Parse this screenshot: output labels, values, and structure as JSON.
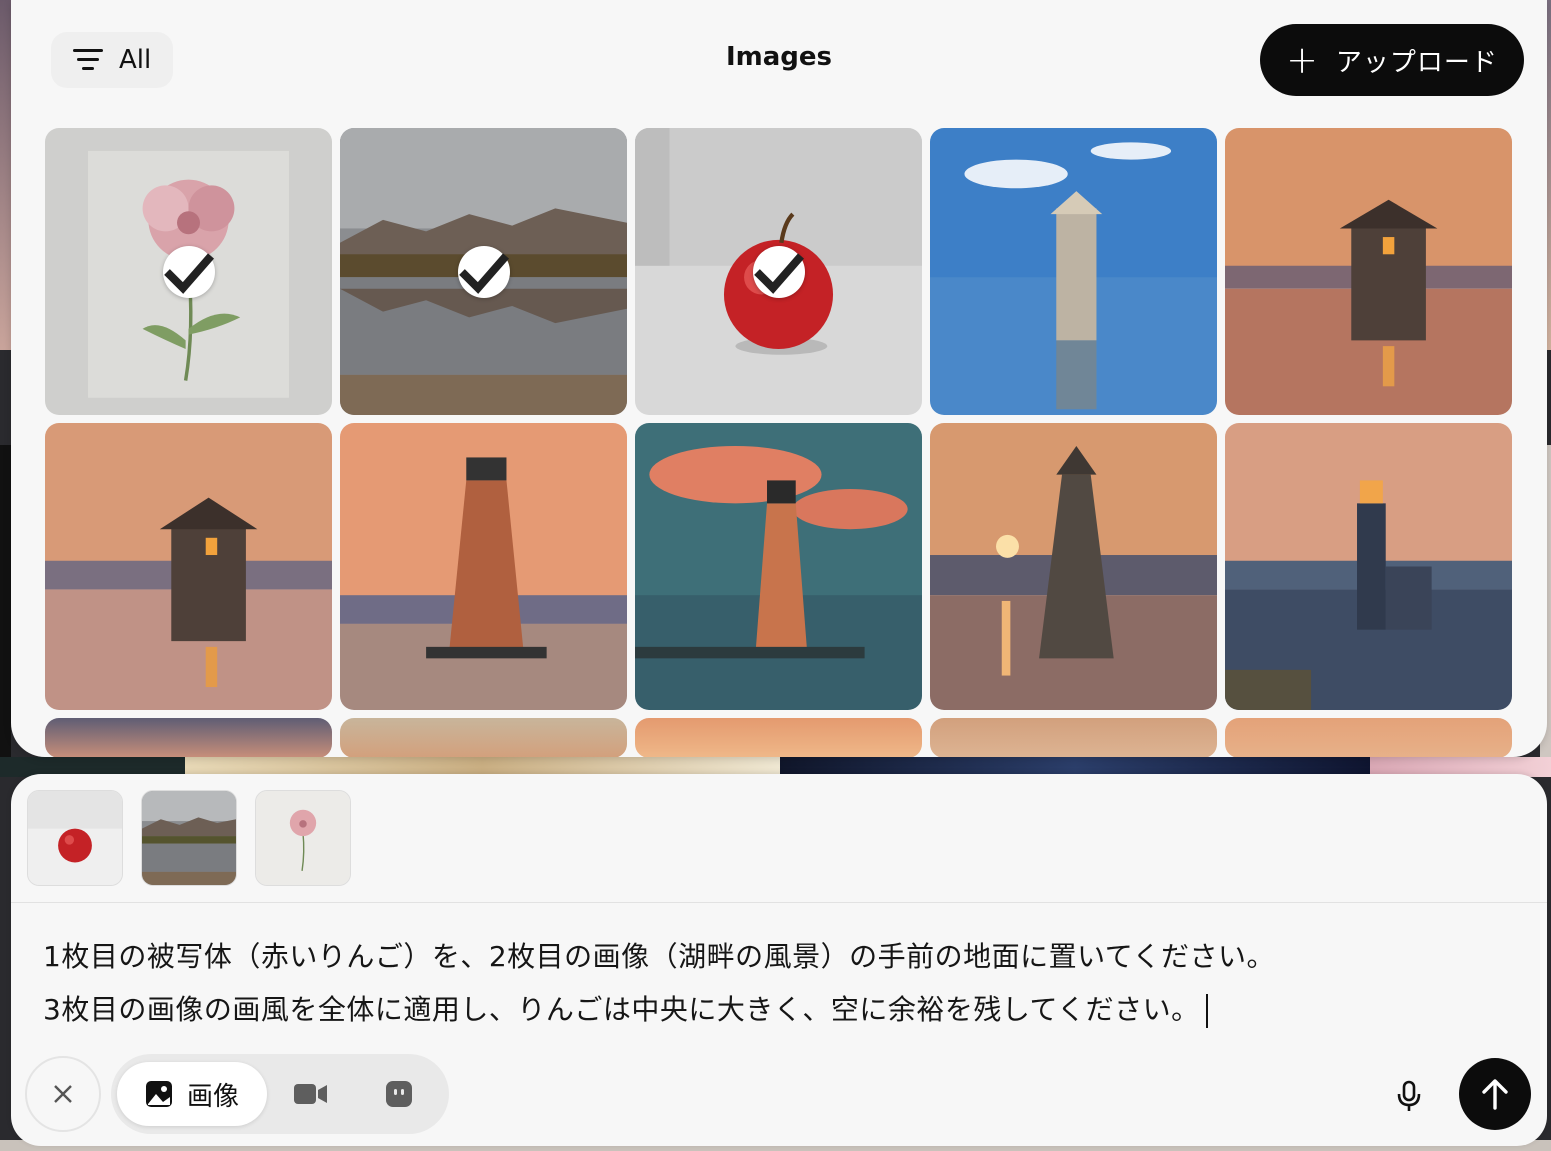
{
  "header": {
    "filter_label": "All",
    "title": "Images",
    "upload_label": "アップロード"
  },
  "grid": {
    "selected_count": 3,
    "rows": [
      [
        "watercolor-flower (selected)",
        "mountain-lake (selected)",
        "red-apple (selected)",
        "blurry-tower-sea",
        "stone-tower-sunset"
      ],
      [
        "stone-tower-sunset-2",
        "lighthouse-sunset",
        "lighthouse-teal-sky",
        "tower-sun-reflection",
        "lighthouse-dusk"
      ]
    ]
  },
  "composer": {
    "attachments": [
      "red-apple",
      "mountain-lake",
      "watercolor-flower"
    ],
    "prompt_line1": "1枚目の被写体（赤いりんご）を、2枚目の画像（湖畔の風景）の手前の地面に置いてください。",
    "prompt_line2": "3枚目の画像の画風を全体に適用し、りんごは中央に大きく、空に余裕を残してください。",
    "mode_label": "画像"
  },
  "colors": {
    "accent": "#0c0c0c",
    "panel": "#f7f7f7"
  }
}
